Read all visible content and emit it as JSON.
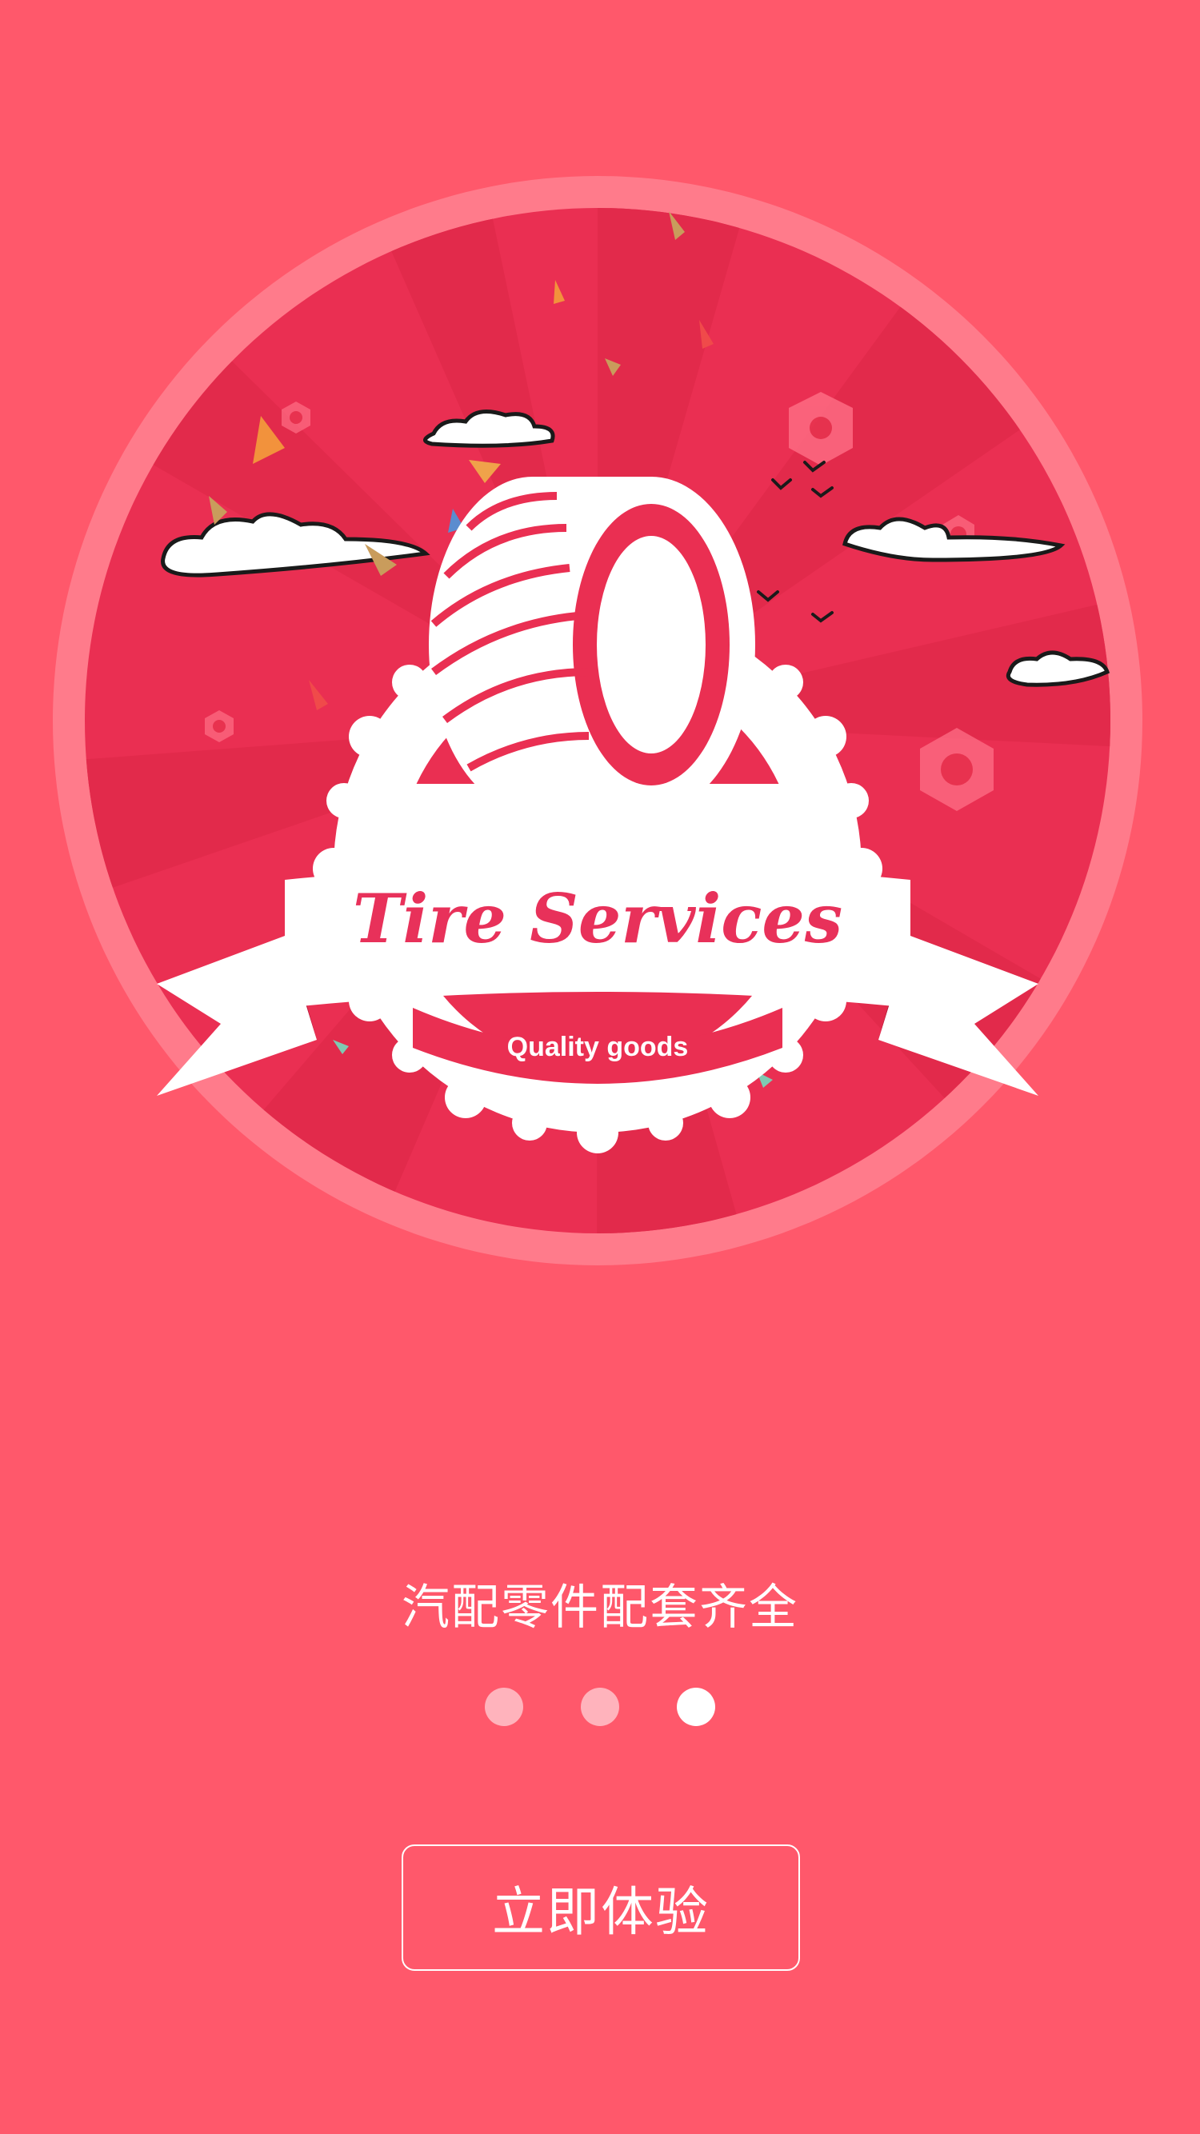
{
  "colors": {
    "background": "#ff586b",
    "ring": "#ff7b8b",
    "disc": "#ea2f52",
    "ray": "#e32a4c",
    "emblem": "#ffffff",
    "accent_text": "#e8315a"
  },
  "hero": {
    "title": "Tire Services",
    "tagline": "Quality goods"
  },
  "subtitle": "汽配零件配套齐全",
  "pager": {
    "count": 3,
    "active_index": 2
  },
  "cta": {
    "label": "立即体验"
  }
}
